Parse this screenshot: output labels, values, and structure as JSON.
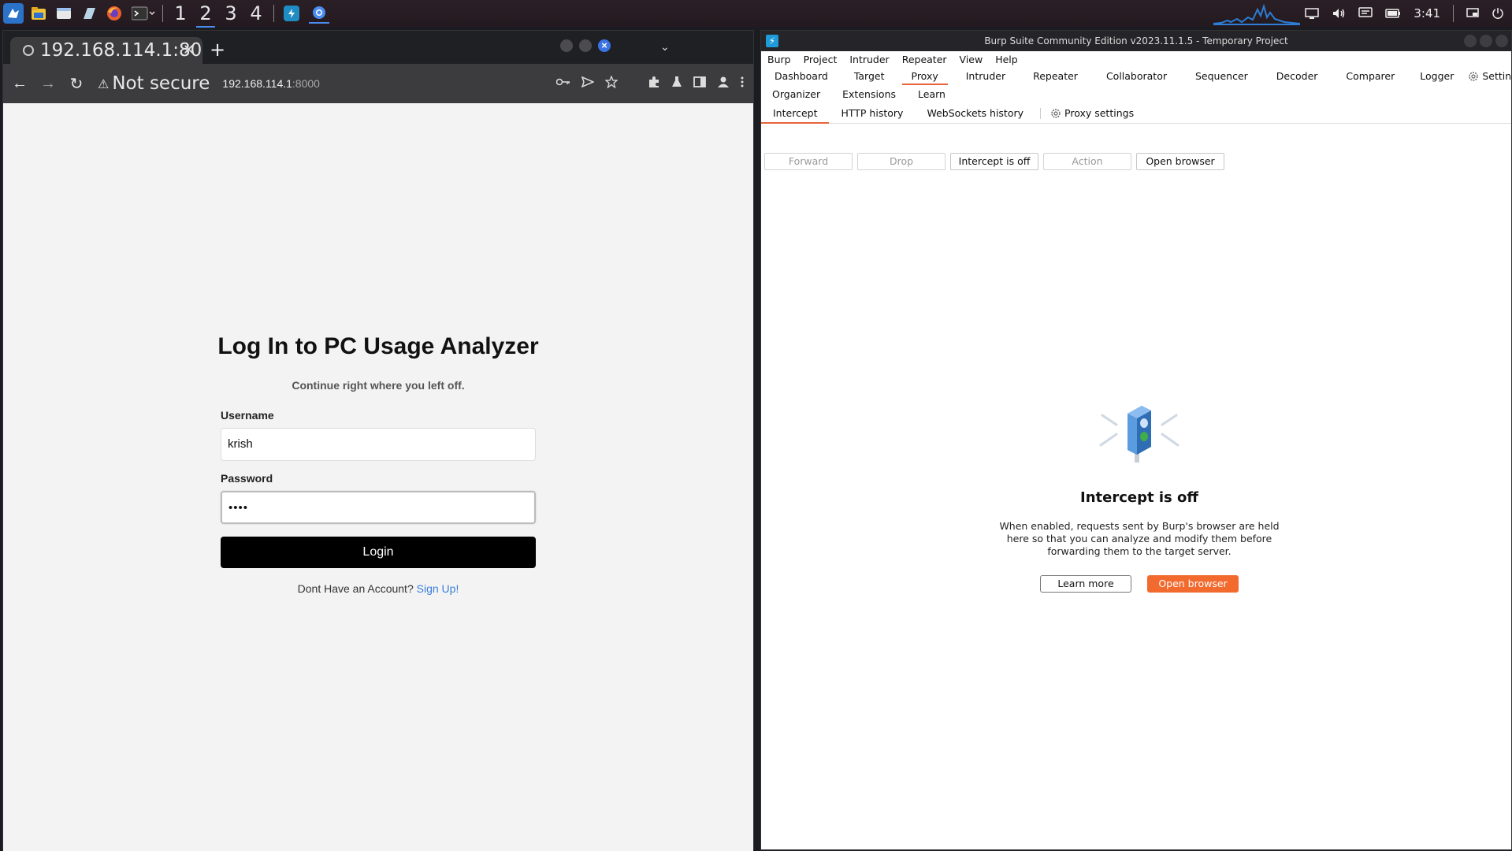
{
  "panel": {
    "workspaces": [
      "1",
      "2",
      "3",
      "4"
    ],
    "active_workspace": "2",
    "clock": "3:41"
  },
  "chrome": {
    "tab_title": "192.168.114.1:80",
    "security_label": "Not secure",
    "url_host": "192.168.114.1",
    "url_port": ":8000"
  },
  "login": {
    "title": "Log In to PC Usage Analyzer",
    "subtitle": "Continue right where you left off.",
    "username_label": "Username",
    "username_value": "krish",
    "password_label": "Password",
    "password_value": "••••",
    "login_button": "Login",
    "signup_prompt": "Dont Have an Account?",
    "signup_link": "Sign Up!"
  },
  "burp": {
    "window_title": "Burp Suite Community Edition v2023.11.1.5 - Temporary Project",
    "menu": [
      "Burp",
      "Project",
      "Intruder",
      "Repeater",
      "View",
      "Help"
    ],
    "tabs_row1": [
      "Dashboard",
      "Target",
      "Proxy",
      "Intruder",
      "Repeater",
      "Collaborator",
      "Sequencer",
      "Decoder",
      "Comparer",
      "Logger",
      "Settings"
    ],
    "tabs_row2": [
      "Organizer",
      "Extensions",
      "Learn"
    ],
    "selected_tab": "Proxy",
    "subtabs": [
      "Intercept",
      "HTTP history",
      "WebSockets history"
    ],
    "proxy_settings": "Proxy settings",
    "buttons": {
      "forward": "Forward",
      "drop": "Drop",
      "intercept": "Intercept is off",
      "action": "Action",
      "open_browser": "Open browser"
    },
    "center": {
      "title": "Intercept is off",
      "description": "When enabled, requests sent by Burp's browser are held here so that you can analyze and modify them before forwarding them to the target server.",
      "learn_more": "Learn more",
      "open_browser": "Open browser"
    },
    "accent_color": "#f26a2e"
  }
}
